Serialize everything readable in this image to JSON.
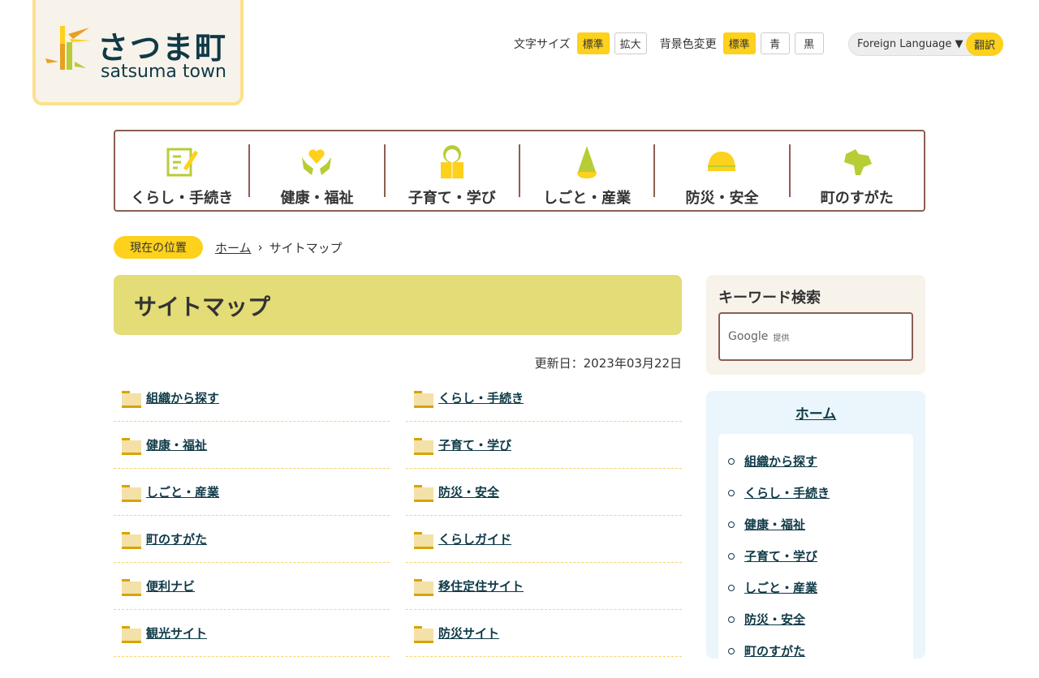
{
  "logo": {
    "jp": "さつま町",
    "en": "satsuma town"
  },
  "tools": {
    "font_size_label": "文字サイズ",
    "font_standard": "標準",
    "font_large": "拡大",
    "bg_label": "背景色変更",
    "bg_standard": "標準",
    "bg_blue": "青",
    "bg_black": "黒",
    "language": "Foreign Language ▼",
    "translate": "翻訳"
  },
  "gnav": [
    {
      "label": "くらし・手続き",
      "icon": "document-pen-icon"
    },
    {
      "label": "健康・福祉",
      "icon": "heart-hands-icon"
    },
    {
      "label": "子育て・学び",
      "icon": "child-book-icon"
    },
    {
      "label": "しごと・産業",
      "icon": "bamboo-shoot-icon"
    },
    {
      "label": "防災・安全",
      "icon": "helmet-icon"
    },
    {
      "label": "町のすがた",
      "icon": "town-map-icon"
    }
  ],
  "breadcrumb": {
    "here": "現在の位置",
    "home": "ホーム",
    "current": "サイトマップ"
  },
  "page_title": "サイトマップ",
  "updated": "更新日：2023年03月22日",
  "sitemap": [
    "組織から探す",
    "くらし・手続き",
    "健康・福祉",
    "子育て・学び",
    "しごと・産業",
    "防災・安全",
    "町のすがた",
    "くらしガイド",
    "便利ナビ",
    "移住定住サイト",
    "観光サイト",
    "防災サイト"
  ],
  "search": {
    "title": "キーワード検索",
    "google": "Google",
    "provided": "提供"
  },
  "side": {
    "home": "ホーム",
    "items": [
      "組織から探す",
      "くらし・手続き",
      "健康・福祉",
      "子育て・学び",
      "しごと・産業",
      "防災・安全",
      "町のすがた"
    ]
  }
}
